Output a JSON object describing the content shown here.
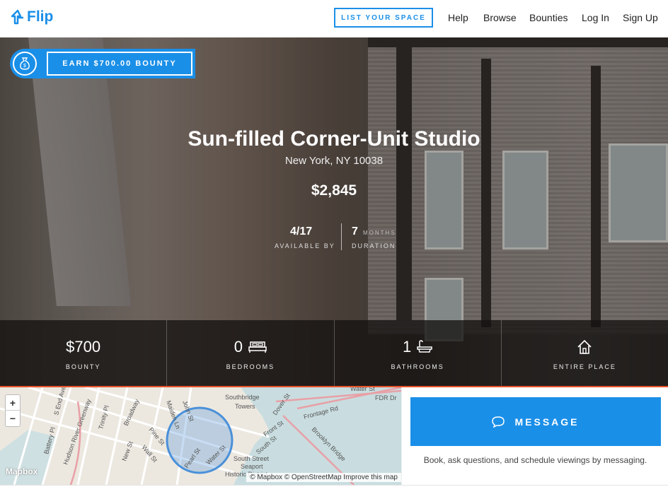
{
  "header": {
    "logo_text": "Flip",
    "list_button": "LIST YOUR SPACE",
    "nav": [
      "Help",
      "Browse",
      "Bounties",
      "Log In",
      "Sign Up"
    ]
  },
  "listing": {
    "bounty_badge": "EARN $700.00 BOUNTY",
    "title": "Sun-filled Corner-Unit Studio",
    "location": "New York, NY 10038",
    "price": "$2,845",
    "available_value": "4/17",
    "available_label": "AVAILABLE BY",
    "duration_value": "7",
    "duration_unit": "MONTHS",
    "duration_label": "DURATION"
  },
  "features": [
    {
      "value": "$700",
      "label": "BOUNTY",
      "icon": ""
    },
    {
      "value": "0",
      "label": "BEDROOMS",
      "icon": "bed-icon"
    },
    {
      "value": "1",
      "label": "BATHROOMS",
      "icon": "bathtub-icon"
    },
    {
      "value": "",
      "label": "ENTIRE PLACE",
      "icon": "house-icon"
    }
  ],
  "map": {
    "zoom_in": "+",
    "zoom_out": "−",
    "logo": "Mapbox",
    "attribution": "© Mapbox © OpenStreetMap Improve this map",
    "labels": [
      "Southbridge Towers",
      "Water St",
      "FDR Dr",
      "Dover St",
      "Frontage Rd",
      "South St",
      "Front St",
      "Brooklyn Bridge",
      "Pearl St",
      "Water St",
      "Wall St",
      "Pine St",
      "Maiden Ln",
      "John St",
      "Broadway",
      "Trinity Pl",
      "New St",
      "Hudson River Greenway",
      "Battery Pl",
      "S End Ave",
      "South Street Seaport Historic District"
    ],
    "accent": "#4a90d9"
  },
  "message": {
    "button_label": "MESSAGE",
    "help_text": "Book, ask questions, and schedule viewings by messaging."
  },
  "colors": {
    "brand": "#1a8fe8",
    "accent_line": "#e8522a"
  }
}
